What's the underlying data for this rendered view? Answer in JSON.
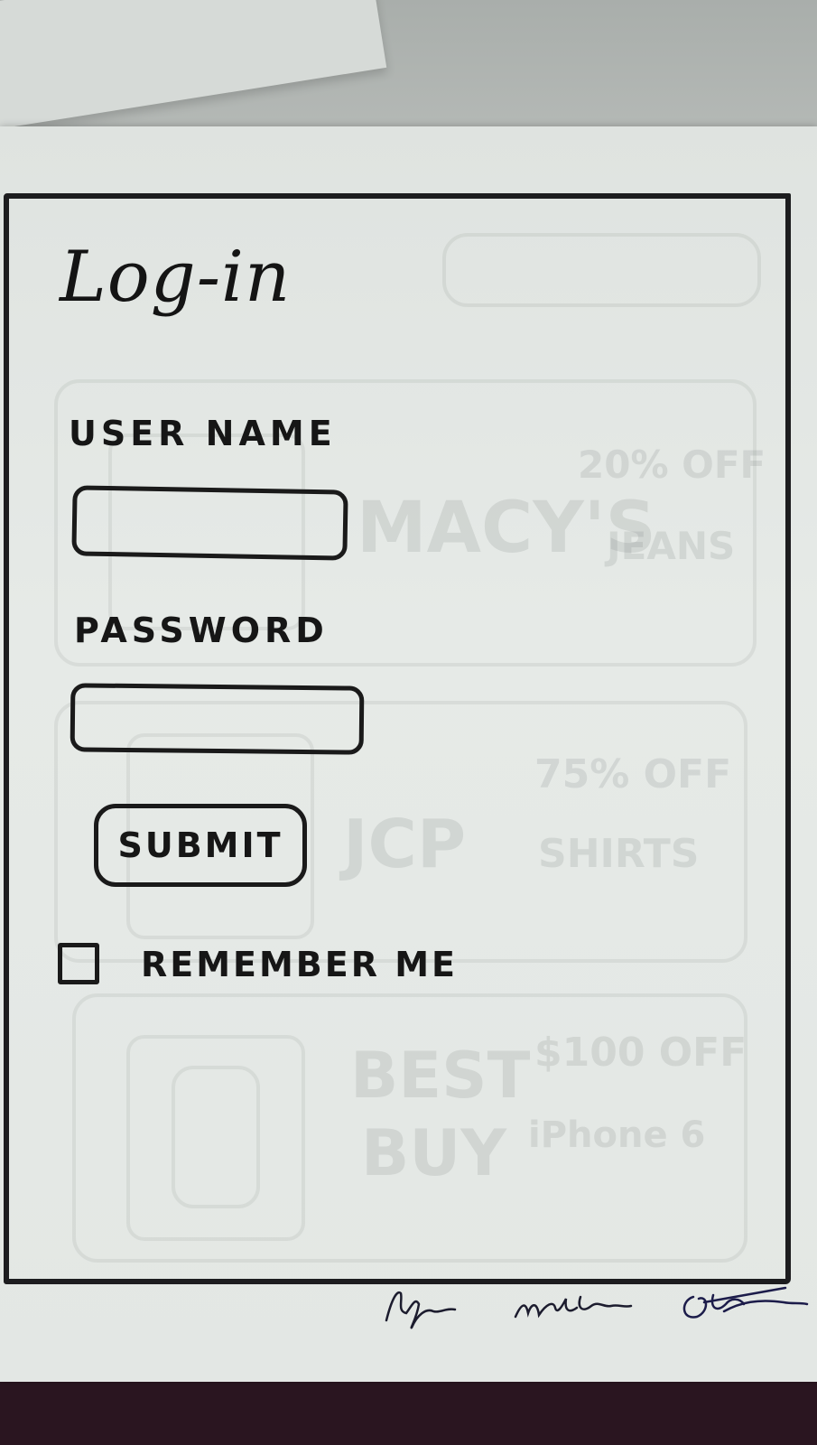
{
  "login_screen": {
    "title": "Log-in",
    "username_label": "USER NAME",
    "username_value": "",
    "password_label": "PASSWORD",
    "password_value": "",
    "submit_label": "SUBMIT",
    "remember_label": "REMEMBER ME",
    "remember_checked": false
  },
  "background_show_through": {
    "card1_store": "MACY'S",
    "card1_deal": [
      "20% OFF",
      "JEANS"
    ],
    "card2_store": "JCP",
    "card2_deal": [
      "75% OFF",
      "SHIRTS"
    ],
    "card3_store": [
      "BEST",
      "BUY"
    ],
    "card3_deal": [
      "$100 OFF",
      "iPhone 6"
    ]
  },
  "colors": {
    "ink": "#1a1a1a",
    "paper": "#e3e7e4",
    "signature_ink": "#1c1c4a"
  },
  "icons": {
    "checkbox": "empty-checkbox-icon"
  }
}
